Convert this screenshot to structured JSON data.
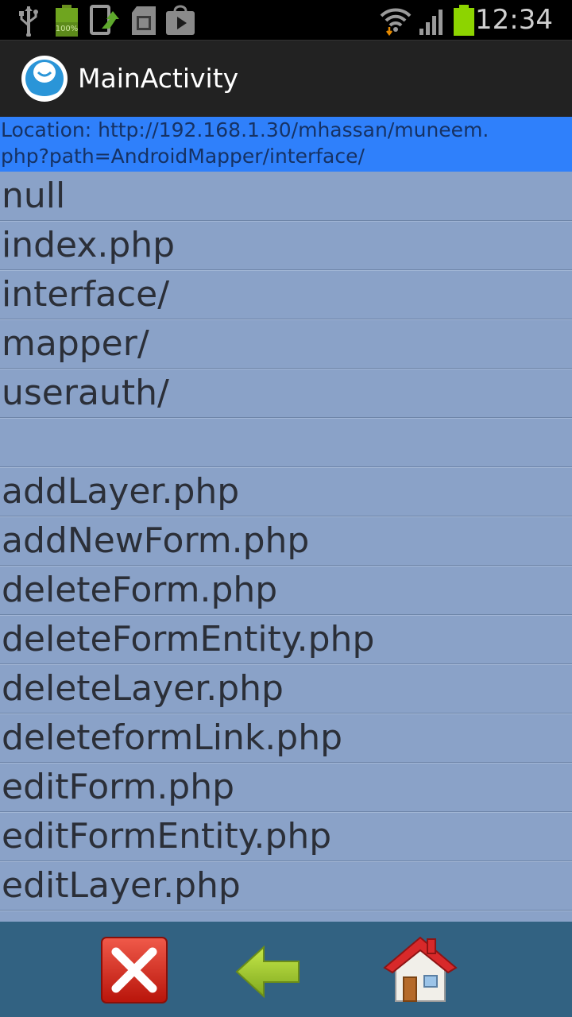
{
  "status_bar": {
    "battery_percent_label": "100%",
    "time": "12:34",
    "icons": [
      "usb-icon",
      "battery-full-icon",
      "phone-update-icon",
      "sd-card-icon",
      "play-store-icon",
      "wifi-icon",
      "signal-icon",
      "battery-icon"
    ]
  },
  "action_bar": {
    "app_icon": "app-logo-icon",
    "title": "MainActivity"
  },
  "location": {
    "line1": "Location: http://192.168.1.30/mhassan/muneem.",
    "line2": "php?path=AndroidMapper/interface/"
  },
  "files": [
    "null",
    "index.php",
    "interface/",
    "mapper/",
    "userauth/",
    "",
    "addLayer.php",
    "addNewForm.php",
    "deleteForm.php",
    "deleteFormEntity.php",
    "deleteLayer.php",
    "deleteformLink.php",
    "editForm.php",
    "editFormEntity.php",
    "editLayer.php"
  ],
  "toolbar": {
    "buttons": [
      "close-icon",
      "back-arrow-icon",
      "home-icon"
    ]
  },
  "colors": {
    "status_bar": "#000000",
    "action_bar": "#222222",
    "location_bar": "#2f80fb",
    "list_background": "#8aa2c8",
    "bottom_bar": "#326282",
    "battery_green": "#8dd400"
  }
}
